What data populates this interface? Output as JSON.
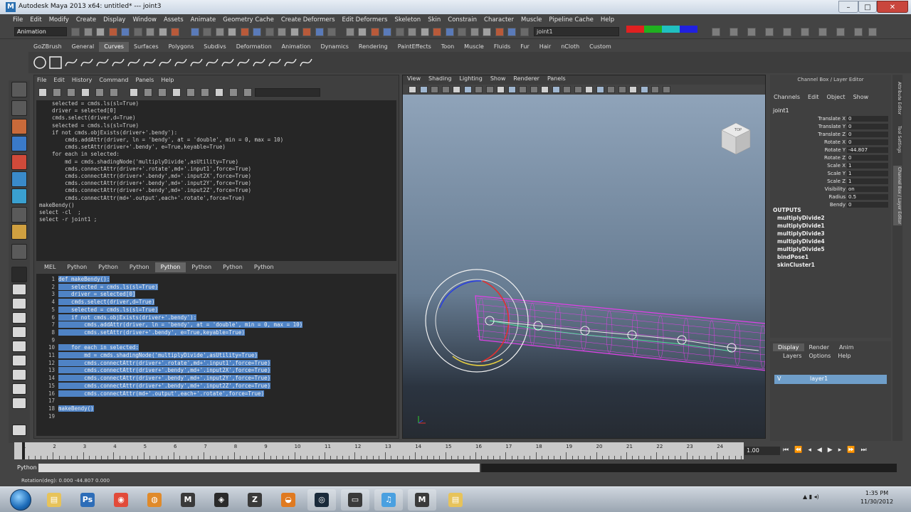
{
  "window": {
    "title": "Autodesk Maya 2013 x64: untitled*   ---   joint3"
  },
  "menubar": [
    "File",
    "Edit",
    "Modify",
    "Create",
    "Display",
    "Window",
    "Assets",
    "Animate",
    "Geometry Cache",
    "Create Deformers",
    "Edit Deformers",
    "Skeleton",
    "Skin",
    "Constrain",
    "Character",
    "Muscle",
    "Pipeline Cache",
    "Help"
  ],
  "statusline": {
    "mode": "Animation",
    "selection_field": "joint1"
  },
  "shelf": {
    "tabs": [
      "GoZBrush",
      "General",
      "Curves",
      "Surfaces",
      "Polygons",
      "Subdivs",
      "Deformation",
      "Animation",
      "Dynamics",
      "Rendering",
      "PaintEffects",
      "Toon",
      "Muscle",
      "Fluids",
      "Fur",
      "Hair",
      "nCloth",
      "Custom"
    ],
    "active_tab": "Curves"
  },
  "script_editor": {
    "menu": [
      "File",
      "Edit",
      "History",
      "Command",
      "Panels",
      "Help"
    ],
    "history_lines": [
      "    selected = cmds.ls(sl=True)",
      "    driver = selected[0]",
      "    cmds.select(driver,d=True)",
      "    selected = cmds.ls(sl=True)",
      "    if not cmds.objExists(driver+'.bendy'):",
      "        cmds.addAttr(driver, ln = 'bendy', at = 'double', min = 0, max = 10)",
      "        cmds.setAttr(driver+'.bendy', e=True,keyable=True)",
      "",
      "    for each in selected:",
      "        md = cmds.shadingNode('multiplyDivide',asUtility=True)",
      "        cmds.connectAttr(driver+'.rotate',md+'.input1',force=True)",
      "        cmds.connectAttr(driver+'.bendy',md+'.input2X',force=True)",
      "        cmds.connectAttr(driver+'.bendy',md+'.input2Y',force=True)",
      "        cmds.connectAttr(driver+'.bendy',md+'.input2Z',force=True)",
      "        cmds.connectAttr(md+'.output',each+'.rotate',force=True)",
      "",
      "makeBendy()",
      "",
      "select -cl  ;",
      "select -r joint1 ;"
    ],
    "tabs": [
      "MEL",
      "Python",
      "Python",
      "Python",
      "Python",
      "Python",
      "Python",
      "Python"
    ],
    "active_tab_index": 4,
    "line_numbers": [
      "1",
      "2",
      "3",
      "4",
      "5",
      "6",
      "7",
      "8",
      "9",
      "10",
      "11",
      "12",
      "13",
      "14",
      "15",
      "16",
      "17",
      "18",
      "19"
    ],
    "code_lines": [
      "def makeBendy():",
      "    selected = cmds.ls(sl=True)",
      "    driver = selected[0]",
      "    cmds.select(driver,d=True)",
      "    selected = cmds.ls(sl=True)",
      "    if not cmds.objExists(driver+'.bendy'):",
      "        cmds.addAttr(driver, ln = 'bendy', at = 'double', min = 0, max = 10)",
      "        cmds.setAttr(driver+'.bendy', e=True,keyable=True)",
      "",
      "    for each in selected:",
      "        md = cmds.shadingNode('multiplyDivide',asUtility=True)",
      "        cmds.connectAttr(driver+'.rotate',md+'.input1',force=True)",
      "        cmds.connectAttr(driver+'.bendy',md+'.input2X',force=True)",
      "        cmds.connectAttr(driver+'.bendy',md+'.input2Y',force=True)",
      "        cmds.connectAttr(driver+'.bendy',md+'.input2Z',force=True)",
      "        cmds.connectAttr(md+'.output',each+'.rotate',force=True)",
      "",
      "makeBendy()",
      ""
    ]
  },
  "viewport": {
    "menu": [
      "View",
      "Shading",
      "Lighting",
      "Show",
      "Renderer",
      "Panels"
    ],
    "viewcube_label": "TOP"
  },
  "channel_box": {
    "title": "Channel Box / Layer Editor",
    "menu": [
      "Channels",
      "Edit",
      "Object",
      "Show"
    ],
    "node": "joint1",
    "attributes": [
      {
        "name": "Translate X",
        "value": "0"
      },
      {
        "name": "Translate Y",
        "value": "0"
      },
      {
        "name": "Translate Z",
        "value": "0"
      },
      {
        "name": "Rotate X",
        "value": "0"
      },
      {
        "name": "Rotate Y",
        "value": "-44.807"
      },
      {
        "name": "Rotate Z",
        "value": "0"
      },
      {
        "name": "Scale X",
        "value": "1"
      },
      {
        "name": "Scale Y",
        "value": "1"
      },
      {
        "name": "Scale Z",
        "value": "1"
      },
      {
        "name": "Visibility",
        "value": "on"
      },
      {
        "name": "Radius",
        "value": "0.5"
      },
      {
        "name": "Bendy",
        "value": "0"
      }
    ],
    "outputs_label": "OUTPUTS",
    "outputs": [
      "multiplyDivide2",
      "multiplyDivide1",
      "multiplyDivide3",
      "multiplyDivide4",
      "multiplyDivide5",
      "bindPose1",
      "skinCluster1"
    ],
    "side_tabs": [
      "Attribute Editor",
      "Tool Settings",
      "Channel Box / Layer Editor"
    ]
  },
  "layer_editor": {
    "tabs": [
      "Display",
      "Render",
      "Anim"
    ],
    "active_tab": "Display",
    "menu": [
      "Layers",
      "Options",
      "Help"
    ],
    "layer": {
      "visible": "V",
      "name": "layer1"
    }
  },
  "timeline": {
    "ticks": [
      "1",
      "2",
      "3",
      "4",
      "5",
      "6",
      "7",
      "8",
      "9",
      "10",
      "11",
      "12",
      "13",
      "14",
      "15",
      "16",
      "17",
      "18",
      "19",
      "20",
      "21",
      "22",
      "23",
      "24"
    ],
    "current_frame": "1.00",
    "playback_glyphs": [
      "⏮",
      "⏪",
      "◂",
      "◀",
      "▶",
      "▸",
      "⏩",
      "⏭"
    ]
  },
  "command_line": {
    "language": "Python"
  },
  "help_line": {
    "text": "Rotation(deg):   0.000     -44.807     0.000"
  },
  "taskbar": {
    "apps": [
      "Explorer",
      "Photoshop",
      "Chrome",
      "Firefox",
      "Maya",
      "Unity",
      "ZBrush",
      "Blender",
      "Steam",
      "Terminal",
      "iTunes",
      "Maya",
      "Explorer"
    ],
    "clock_time": "1:35 PM",
    "clock_date": "11/30/2012"
  },
  "colors": {
    "maya_accent": "#2a6fb0",
    "selection_highlight": "#4f83c5",
    "wire_magenta": "#e040e8",
    "layer_row": "#6f9ec9"
  }
}
